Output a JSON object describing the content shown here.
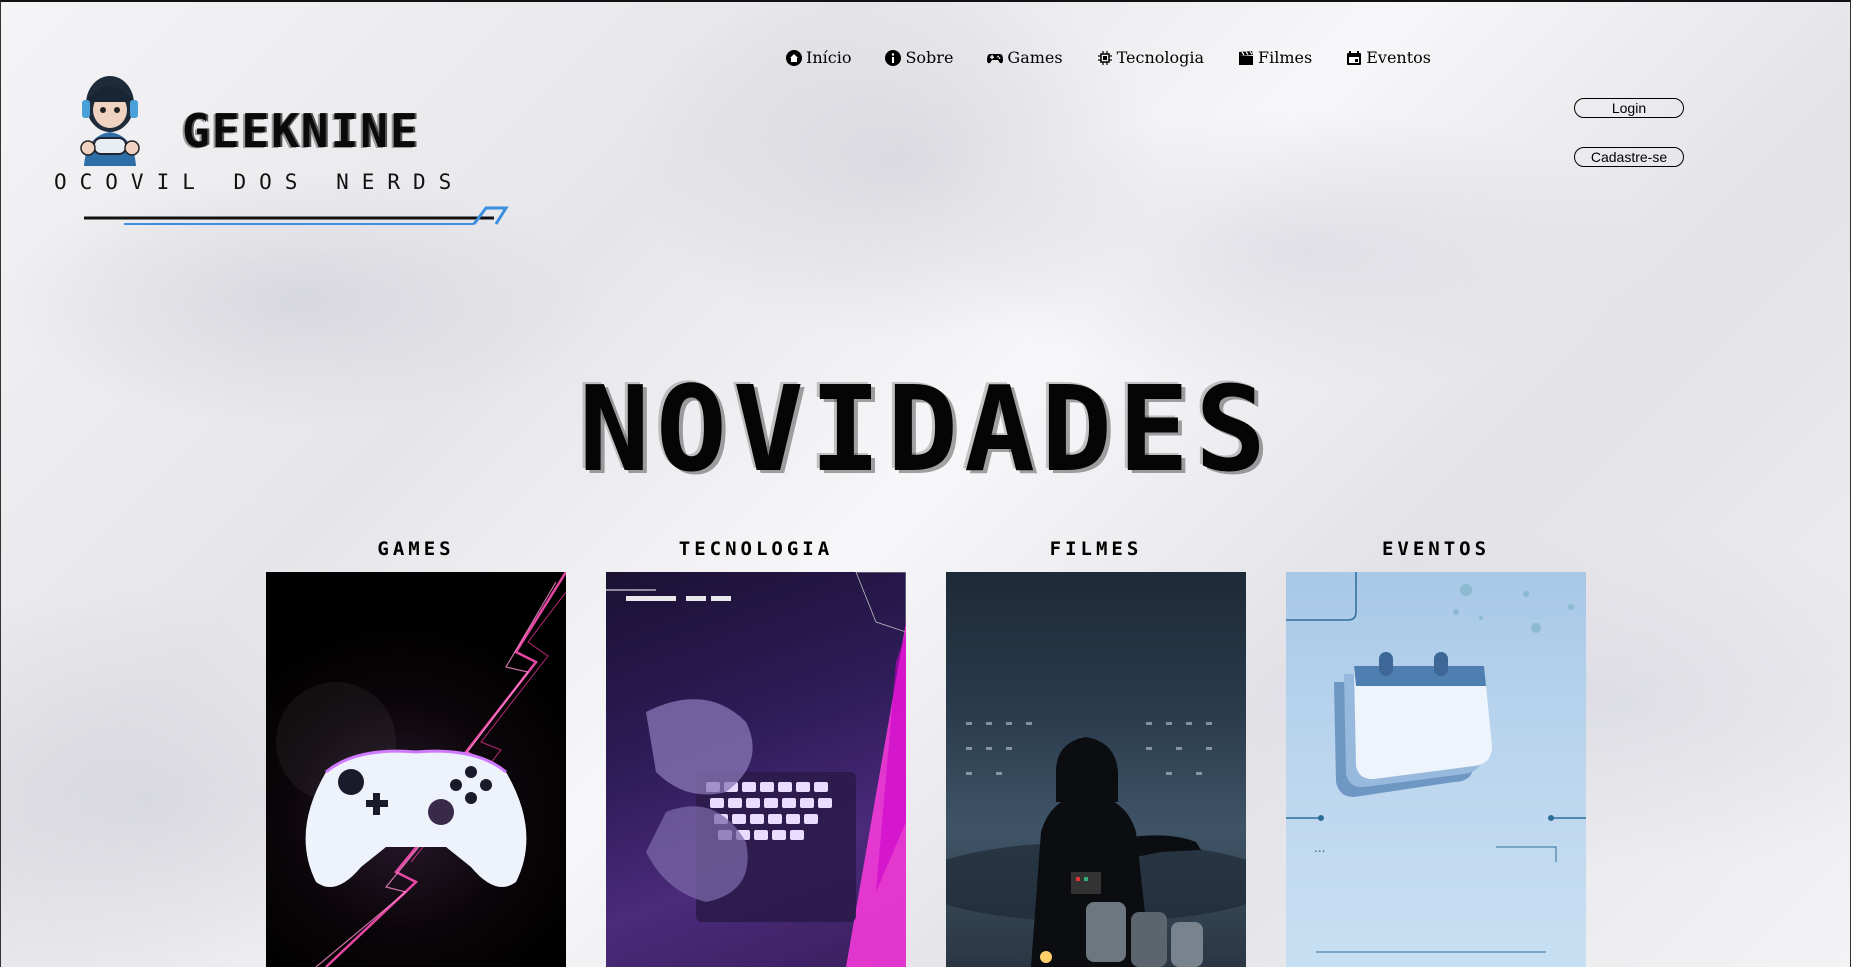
{
  "logo": {
    "brand": "GEEKNINE",
    "tagline": "OCOVIL DOS NERDS"
  },
  "nav": [
    {
      "label": "Início",
      "icon": "home-icon"
    },
    {
      "label": "Sobre",
      "icon": "info-icon"
    },
    {
      "label": "Games",
      "icon": "gamepad-icon"
    },
    {
      "label": "Tecnologia",
      "icon": "cpu-icon"
    },
    {
      "label": "Filmes",
      "icon": "clapperboard-icon"
    },
    {
      "label": "Eventos",
      "icon": "calendar-icon"
    }
  ],
  "auth": {
    "login_label": "Login",
    "signup_label": "Cadastre-se"
  },
  "headline": "NOVIDADES",
  "cards": [
    {
      "title": "GAMES",
      "image": "game-controller-image"
    },
    {
      "title": "TECNOLOGIA",
      "image": "laptop-keyboard-image"
    },
    {
      "title": "FILMES",
      "image": "darth-vader-image"
    },
    {
      "title": "EVENTOS",
      "image": "calendar-3d-image"
    }
  ]
}
